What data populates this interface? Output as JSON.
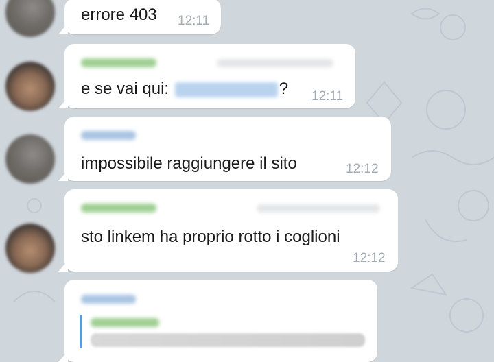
{
  "colors": {
    "chat_background": "#cfd6dc",
    "bubble_background": "#ffffff",
    "timestamp": "#a3acb3",
    "sender_green": "#9fcf92",
    "sender_blue": "#a9c4e2",
    "quote_bar": "#5a9bd5",
    "link_blue": "#b9d2ee"
  },
  "messages": [
    {
      "text": "errore 403",
      "time": "12:11"
    },
    {
      "text_prefix": "e se vai qui: ",
      "text_suffix": "?",
      "time": "12:11"
    },
    {
      "text": "impossibile raggiungere il sito",
      "time": "12:12"
    },
    {
      "text": "sto linkem ha proprio rotto i coglioni",
      "time": "12:12"
    }
  ]
}
